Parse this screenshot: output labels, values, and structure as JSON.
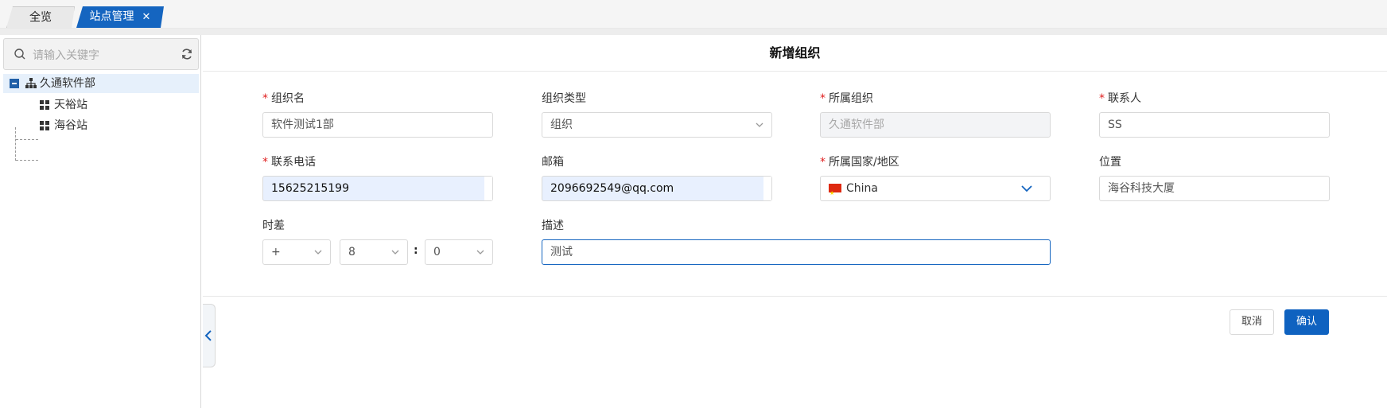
{
  "tabs": [
    {
      "label": "全览"
    },
    {
      "label": "站点管理",
      "close": "✕"
    }
  ],
  "sidebar": {
    "search_placeholder": "请输入关键字",
    "tree": {
      "root": "久通软件部",
      "children": [
        "天裕站",
        "海谷站"
      ]
    }
  },
  "form": {
    "title": "新增组织",
    "required_mark": "*",
    "org_name": {
      "label": "组织名",
      "value": "软件测试1部"
    },
    "org_type": {
      "label": "组织类型",
      "value": "组织"
    },
    "parent_org": {
      "label": "所属组织",
      "value": "久通软件部"
    },
    "contact": {
      "label": "联系人",
      "value": "SS"
    },
    "phone": {
      "label": "联系电话",
      "value": "15625215199"
    },
    "email": {
      "label": "邮箱",
      "value": "2096692549@qq.com"
    },
    "country": {
      "label": "所属国家/地区",
      "value": "China"
    },
    "location": {
      "label": "位置",
      "value": "海谷科技大厦"
    },
    "timezone": {
      "label": "时差",
      "sign": "+",
      "hours": "8",
      "separator": ":",
      "minutes": "0"
    },
    "description": {
      "label": "描述",
      "value": "测试"
    },
    "cancel_label": "取消",
    "confirm_label": "确认"
  },
  "colors": {
    "accent": "#1565c0",
    "required": "#e02020"
  }
}
